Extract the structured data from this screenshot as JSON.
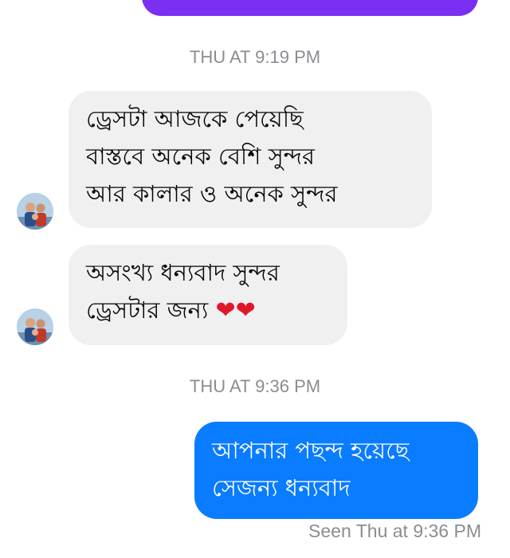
{
  "timestamps": [
    "THU AT 9:19 PM",
    "THU AT 9:36 PM"
  ],
  "incoming": [
    {
      "lines": [
        "ড্রেসটা আজকে পেয়েছি",
        "বাস্তবে অনেক বেশি সুন্দর",
        "আর কালার ও অনেক সুন্দর"
      ]
    },
    {
      "lines": [
        "অসংখ্য ধন্যবাদ সুন্দর",
        "ড্রেসটার জন্য"
      ],
      "emoji": "❤❤"
    }
  ],
  "outgoing": {
    "lines": [
      "আপনার পছন্দ হয়েছে",
      "সেজন্য ধন্যবাদ"
    ]
  },
  "seen_status": "Seen Thu at 9:36 PM",
  "colors": {
    "incoming_bubble": "#f0f0f0",
    "outgoing_bubble": "#0a7cff",
    "previous_bubble": "#7b2ff2",
    "timestamp": "#8a8d91"
  }
}
